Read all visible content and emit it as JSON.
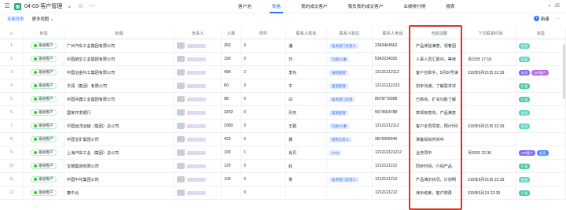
{
  "app": {
    "title": "04-03-客户管理",
    "tabs": [
      {
        "label": "客户池",
        "active": false
      },
      {
        "label": "表格",
        "active": true
      },
      {
        "label": "我的成交客户",
        "active": false
      },
      {
        "label": "我负责的成交客户",
        "active": false
      },
      {
        "label": "业绩排行榜",
        "active": false
      },
      {
        "label": "报表",
        "active": false
      }
    ],
    "right_label": "25"
  },
  "toolbar": {
    "items": [
      {
        "label": "全部任务",
        "active": true
      },
      {
        "label": "更多视图 ⌄",
        "active": false
      }
    ],
    "new_label": "新建",
    "more_label": "···"
  },
  "table": {
    "columns": [
      "",
      "状态",
      "标题",
      "负责人",
      "人数",
      "附件",
      "联系人姓名",
      "联系人职位",
      "联系人电话",
      "当前进展",
      "下次联系时间",
      "标签"
    ],
    "rows": [
      {
        "no": "1",
        "status": "跟进客户",
        "title": "广州汽车工业集团有限公司",
        "count": "353",
        "attach": "0",
        "contact": "潘",
        "position": "技术部门负责人",
        "phone": "2343464563",
        "progress": "产品体验满意，领着团",
        "next": "",
        "tags": [
          {
            "text": "标签",
            "color": "#5ed4c4"
          }
        ]
      },
      {
        "no": "2",
        "status": "跟进客户",
        "title": "中国航空工业集团有限公司",
        "count": "150",
        "attach": "0",
        "contact": "日",
        "position": "行政/人事",
        "phone": "5342234325",
        "progress": "人事人员汇报中，等待",
        "next": "月23日 17:18",
        "tags": [
          {
            "text": "标签",
            "color": "#5ed4c4"
          }
        ]
      },
      {
        "no": "3",
        "status": "跟进客户",
        "title": "中国冶金科工集团有限公司",
        "count": "490",
        "attach": "2",
        "contact": "李先",
        "position": "采购经理",
        "phone": "12121212112",
        "progress": "客户也举手，5月30号来",
        "next": "019年6月21日 22:39",
        "tags": [
          {
            "text": "标签",
            "color": "#7b6ff0"
          },
          {
            "text": "VIP客户",
            "color": "#b36ee8"
          }
        ]
      },
      {
        "no": "4",
        "status": "跟进客户",
        "title": "华润（集团）有限公司",
        "count": "60",
        "attach": "0",
        "contact": "牛",
        "position": "渠道管理",
        "phone": "12121212123",
        "progress": "初步沟通，了解需求详",
        "next": "",
        "tags": [
          {
            "text": "扩展",
            "color": "#4cc9a6"
          }
        ]
      },
      {
        "no": "5",
        "status": "跟进客户",
        "title": "中国兵器工业集团有限公司",
        "count": "98",
        "attach": "0",
        "contact": "白",
        "position": "技术部门负责",
        "phone": "8978778998",
        "progress": "已购买，扩充功能了解",
        "next": "",
        "tags": [
          {
            "text": "扩展",
            "color": "#4cc9a6"
          }
        ]
      },
      {
        "no": "6",
        "status": "跟进客户",
        "title": "国家开发银行",
        "count": "3242",
        "attach": "0",
        "contact": "孙天",
        "position": "渠道经理",
        "phone": "5674564788",
        "progress": "表现有意向，产品满意",
        "next": "",
        "tags": [
          {
            "text": "标签",
            "color": "#5ed4c4"
          }
        ]
      },
      {
        "no": "7",
        "status": "跟进客户",
        "title": "中国远洋运输（集团）总公司",
        "count": "2000",
        "attach": "0",
        "contact": "王勤",
        "position": "行政/人事",
        "phone": "12121212112",
        "progress": "客户全员同意，预计5月",
        "next": "019年6月21日 22:39",
        "tags": [
          {
            "text": "标签",
            "color": "#5ed4c4"
          }
        ]
      },
      {
        "no": "8",
        "status": "跟进客户",
        "title": "中国五矿集团公司",
        "count": "423",
        "attach": "0",
        "contact": "龚",
        "position": "财务负责人",
        "phone": "9876995646",
        "progress": "准备投标时间中",
        "next": "",
        "tags": []
      },
      {
        "no": "9",
        "status": "跟进客户",
        "title": "上海汽车工业（集团）总公司",
        "count": "100",
        "attach": "1",
        "contact": "肖贝",
        "position": "CTO",
        "phone": "121212121212",
        "progress": "业务同中",
        "next": "月30日 22:36",
        "tags": [
          {
            "text": "VIP客户",
            "color": "#7b6ff0"
          },
          {
            "text": "标签",
            "color": "#4f8cf7"
          }
        ]
      },
      {
        "no": "10",
        "status": "跟进客户",
        "title": "宝钢集团有限公司",
        "count": "120",
        "attach": "0",
        "contact": "赵",
        "position": "",
        "phone": "1212121212",
        "progress": "同步时间，介绍产品",
        "next": "",
        "tags": [
          {
            "text": "扩展",
            "color": "#4cc9a6"
          }
        ]
      },
      {
        "no": "11",
        "status": "跟进客户",
        "title": "中国中化集团公司",
        "count": "100",
        "attach": "0",
        "contact": "吴",
        "position": "技术部门负责人",
        "phone": "1212121212",
        "progress": "产品演示状况，计划明",
        "next": "019年6月21日 22:39",
        "tags": [
          {
            "text": "标签",
            "color": "#5ed4c4"
          }
        ]
      },
      {
        "no": "12",
        "status": "跟进客户",
        "title": "春中合",
        "count": "",
        "attach": "0",
        "contact": "",
        "position": "",
        "phone": "1212121212",
        "progress": "演示结束，客户想再",
        "next": "019年6月19 22:39",
        "tags": [
          {
            "text": "扩展",
            "color": "#4cc9a6"
          }
        ]
      }
    ]
  },
  "highlight_color": "#d3362f"
}
